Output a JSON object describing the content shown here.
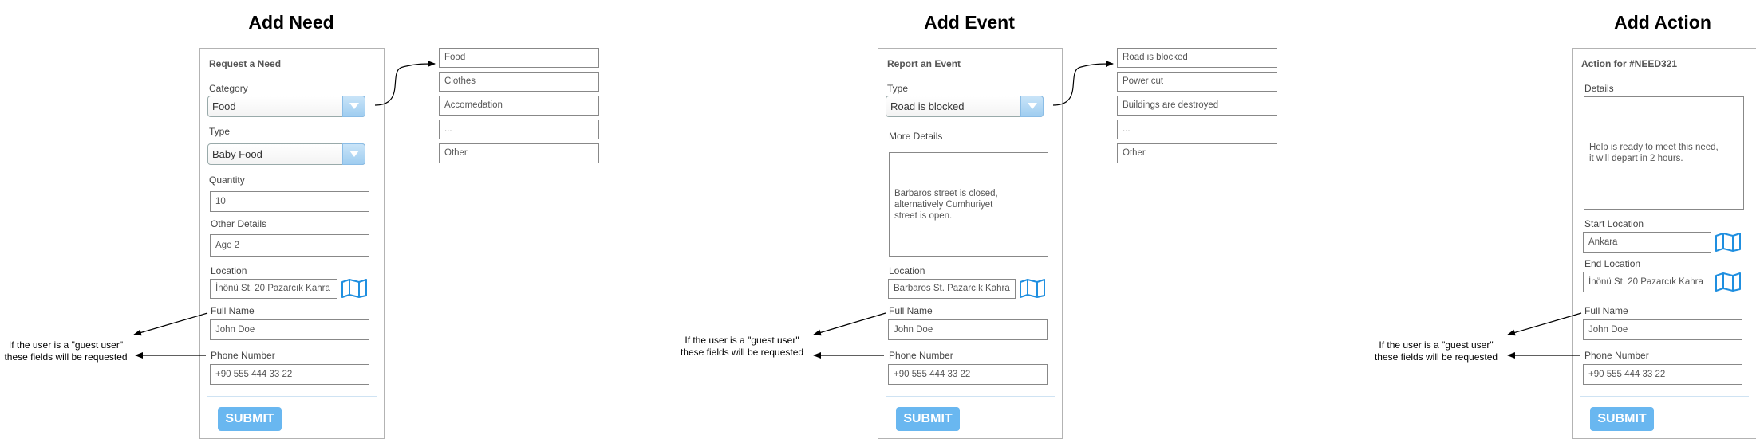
{
  "need": {
    "title": "Add Need",
    "heading": "Request a Need",
    "category_label": "Category",
    "category_value": "Food",
    "type_label": "Type",
    "type_value": "Baby Food",
    "quantity_label": "Quantity",
    "quantity_value": "10",
    "other_label": "Other Details",
    "other_value": "Age 2",
    "location_label": "Location",
    "location_value": "İnönü St. 20 Pazarcık Kahra",
    "fullname_label": "Full Name",
    "fullname_value": "John Doe",
    "phone_label": "Phone Number",
    "phone_value": "+90 555 444 33 22",
    "submit": "SUBMIT",
    "options": [
      "Food",
      "Clothes",
      "Accomedation",
      "...",
      "Other"
    ],
    "note_line1": "If the user is a \"guest user\"",
    "note_line2": "these fields will be requested"
  },
  "event": {
    "title": "Add Event",
    "heading": "Report an Event",
    "type_label": "Type",
    "type_value": "Road is blocked",
    "details_label": "More Details",
    "details_value": "Barbaros street is closed,\nalternatively Cumhuriyet\nstreet is open.",
    "location_label": "Location",
    "location_value": "Barbaros St. Pazarcık Kahra",
    "fullname_label": "Full Name",
    "fullname_value": "John Doe",
    "phone_label": "Phone Number",
    "phone_value": "+90 555 444 33 22",
    "submit": "SUBMIT",
    "options": [
      "Road is blocked",
      "Power cut",
      "Buildings are destroyed",
      "...",
      "Other"
    ],
    "note_line1": "If the user is a \"guest user\"",
    "note_line2": "these fields will be requested"
  },
  "action": {
    "title": "Add Action",
    "heading": "Action for #NEED321",
    "details_label": "Details",
    "details_value": "Help is ready to meet this need,\nit will depart in 2 hours.",
    "start_label": "Start Location",
    "start_value": "Ankara",
    "end_label": "End Location",
    "end_value": "İnönü St. 20 Pazarcık Kahra",
    "fullname_label": "Full Name",
    "fullname_value": "John Doe",
    "phone_label": "Phone Number",
    "phone_value": "+90 555 444 33 22",
    "submit": "SUBMIT",
    "note_line1": "If the user is a \"guest user\"",
    "note_line2": "these fields will be requested"
  },
  "colors": {
    "accent": "#69b7f0",
    "map_icon": "#1f8fe0",
    "separator": "#cfe3f3"
  },
  "icons": {
    "map": "map-icon",
    "dropdown": "chevron-down-icon"
  }
}
